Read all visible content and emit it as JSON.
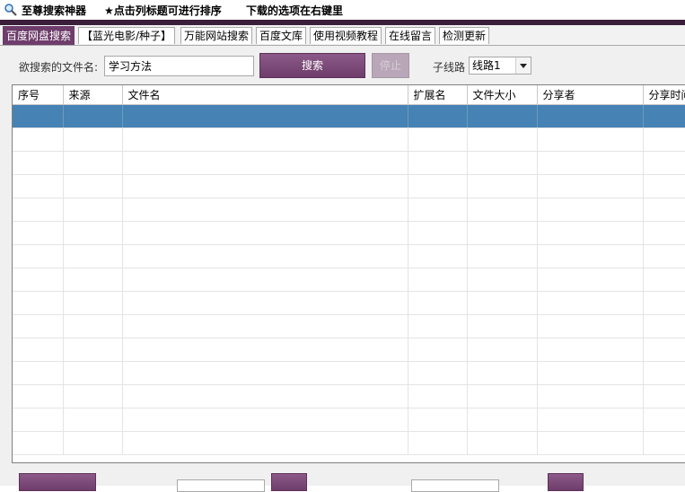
{
  "titlebar": {
    "app_name": "至尊搜索神器",
    "hint_sort": "★点击列标题可进行排序",
    "hint_download": "下载的选项在右键里"
  },
  "tabs": [
    {
      "label": "百度网盘搜索",
      "active": true
    },
    {
      "label": "【蓝光电影/种子】",
      "active": false
    },
    {
      "label": "万能网站搜索",
      "active": false
    },
    {
      "label": "百度文库",
      "active": false
    },
    {
      "label": "使用视频教程",
      "active": false
    },
    {
      "label": "在线留言",
      "active": false
    },
    {
      "label": "检测更新",
      "active": false
    }
  ],
  "search": {
    "label": "欲搜索的文件名:",
    "value": "学习方法",
    "search_button": "搜索",
    "stop_button": "停止",
    "route_label": "子线路",
    "route_value": "线路1"
  },
  "table": {
    "columns": [
      "序号",
      "来源",
      "文件名",
      "扩展名",
      "文件大小",
      "分享者",
      "分享时间"
    ],
    "rows": 15,
    "selected_row": 0
  },
  "colors": {
    "accent": "#6e3d6b",
    "selection": "#4682b4",
    "title_dark": "#3b1f3a"
  }
}
